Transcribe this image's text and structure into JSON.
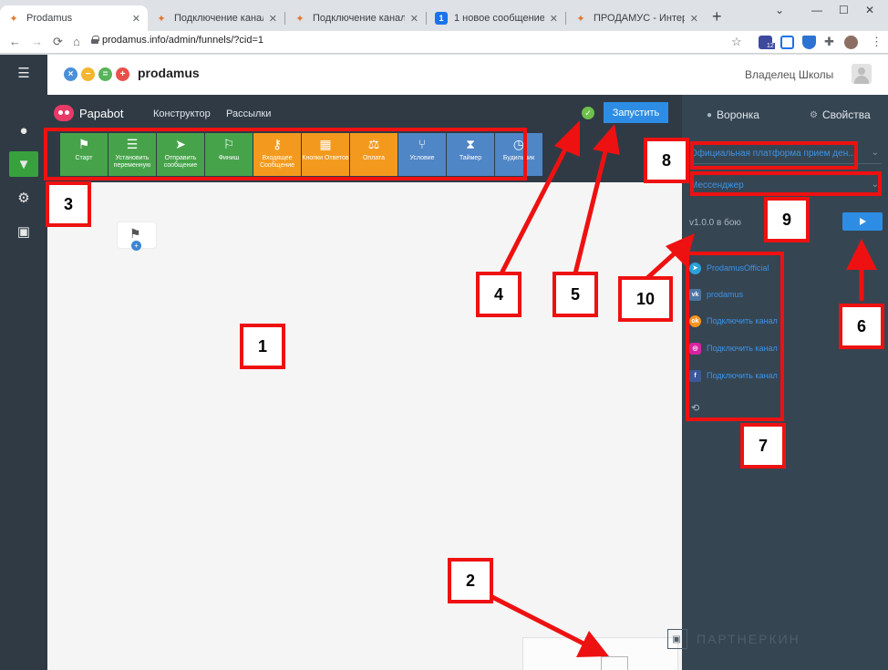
{
  "browser": {
    "tabs": [
      {
        "title": "Prodamus",
        "active": true
      },
      {
        "title": "Подключение канала Tel",
        "active": false
      },
      {
        "title": "Подключение канала Ins",
        "active": false
      },
      {
        "title": "1 новое сообщение",
        "badge": "1",
        "active": false
      },
      {
        "title": "ПРОДАМУС - Интернет",
        "active": false
      }
    ],
    "close_glyph": "✕",
    "new_tab_glyph": "+",
    "url": "prodamus.info/admin/funnels/?cid=1",
    "extension_badge": "12"
  },
  "app": {
    "brand": "prodamus",
    "owner": "Владелец Школы"
  },
  "editor": {
    "product": "Papabot",
    "menu": [
      "Конструктор",
      "Рассылки"
    ],
    "run_label": "Запустить",
    "check_glyph": "✓",
    "blocks": [
      {
        "label": "Старт",
        "icon": "flag-icon",
        "glyph": "⚑",
        "color": "#46a34a"
      },
      {
        "label": "Установить переменную",
        "icon": "sliders-icon",
        "glyph": "☰",
        "color": "#46a34a"
      },
      {
        "label": "Отправить сообщение",
        "icon": "send-icon",
        "glyph": "➤",
        "color": "#46a34a"
      },
      {
        "label": "Финиш",
        "icon": "finish-flag-icon",
        "glyph": "⚐",
        "color": "#46a34a"
      },
      {
        "label": "Входящее Сообщение",
        "icon": "key-icon",
        "glyph": "⚷",
        "color": "#f39a1e"
      },
      {
        "label": "Кнопки Ответов",
        "icon": "grid-icon",
        "glyph": "▦",
        "color": "#f39a1e"
      },
      {
        "label": "Оплата",
        "icon": "scales-icon",
        "glyph": "⚖",
        "color": "#f39a1e"
      },
      {
        "label": "Условие",
        "icon": "branch-icon",
        "glyph": "⑂",
        "color": "#4f86c6"
      },
      {
        "label": "Таймер",
        "icon": "hourglass-icon",
        "glyph": "⧗",
        "color": "#4f86c6"
      },
      {
        "label": "Будильник",
        "icon": "clock-icon",
        "glyph": "◷",
        "color": "#4f86c6"
      }
    ]
  },
  "canvas": {
    "node_glyph": "⚑",
    "plus_glyph": "+"
  },
  "right_panel": {
    "tabs": [
      {
        "label": "Воронка",
        "icon": "chat-icon",
        "glyph": "●"
      },
      {
        "label": "Свойства",
        "icon": "gear-icon",
        "glyph": "⚙"
      }
    ],
    "funnel_select": "Официальная платформа прием ден...",
    "messenger_select": "Мессенджер",
    "chevron_glyph": "⌄",
    "version": "v1.0.0 в бою",
    "channels": [
      {
        "label": "ProdamusOfficial",
        "icon": "telegram-icon",
        "glyph": "➤",
        "color": "#2aa1da"
      },
      {
        "label": "prodamus",
        "icon": "vk-icon",
        "glyph": "vk",
        "color": "#4c75a3"
      },
      {
        "label": "Подключить канал",
        "icon": "ok-icon",
        "glyph": "ok",
        "color": "#f7931e"
      },
      {
        "label": "Подключить канал",
        "icon": "instagram-icon",
        "glyph": "◎",
        "color": "#d6249f"
      },
      {
        "label": "Подключить канал",
        "icon": "facebook-icon",
        "glyph": "f",
        "color": "#3b5998"
      }
    ],
    "loop_glyph": "⟲",
    "watermark": "ПАРТНЕРКИН"
  },
  "annotations": [
    "1",
    "2",
    "3",
    "4",
    "5",
    "6",
    "7",
    "8",
    "9",
    "10"
  ]
}
